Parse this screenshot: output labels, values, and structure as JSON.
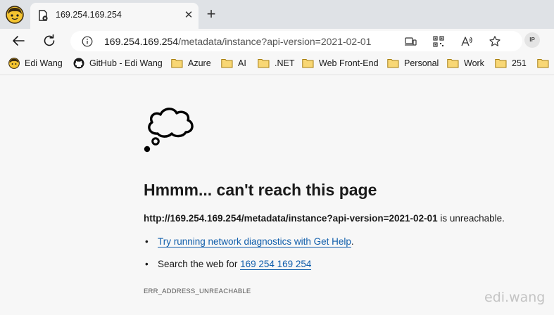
{
  "browser": {
    "tab": {
      "title": "169.254.169.254",
      "close_glyph": "✕"
    },
    "new_tab_glyph": "+",
    "address": {
      "url_host": "169.254.169.254",
      "url_path": "/metadata/instance?api-version=2021-02-01"
    },
    "profile_initials": "IP",
    "icons": [
      "back-arrow-icon",
      "refresh-icon",
      "info-icon",
      "app-available-icon",
      "qr-code-icon",
      "read-aloud-icon",
      "favorite-star-icon"
    ],
    "bookmarks": [
      {
        "label": "Edi Wang",
        "icon": "avatar-icon"
      },
      {
        "label": "GitHub - Edi Wang",
        "icon": "github-icon"
      },
      {
        "label": "Azure",
        "icon": "folder-icon"
      },
      {
        "label": "AI",
        "icon": "folder-icon"
      },
      {
        "label": ".NET",
        "icon": "folder-icon"
      },
      {
        "label": "Web Front-End",
        "icon": "folder-icon"
      },
      {
        "label": "Personal",
        "icon": "folder-icon"
      },
      {
        "label": "Work",
        "icon": "folder-icon"
      },
      {
        "label": "251",
        "icon": "folder-icon"
      }
    ]
  },
  "error": {
    "heading": "Hmmm... can't reach this page",
    "status_url": "http://169.254.169.254/metadata/instance?api-version=2021-02-01",
    "status_suffix": " is unreachable.",
    "suggestion_1_link": "Try running network diagnostics with Get Help",
    "suggestion_1_suffix": ".",
    "suggestion_2_prefix": "Search the web for ",
    "suggestion_2_link": "169 254 169 254",
    "bullet": "•",
    "code": "ERR_ADDRESS_UNREACHABLE"
  },
  "watermark": "edi.wang",
  "colors": {
    "link": "#0f5dab",
    "folder": "#f2c94c",
    "tabstrip": "#dfe2e6"
  }
}
